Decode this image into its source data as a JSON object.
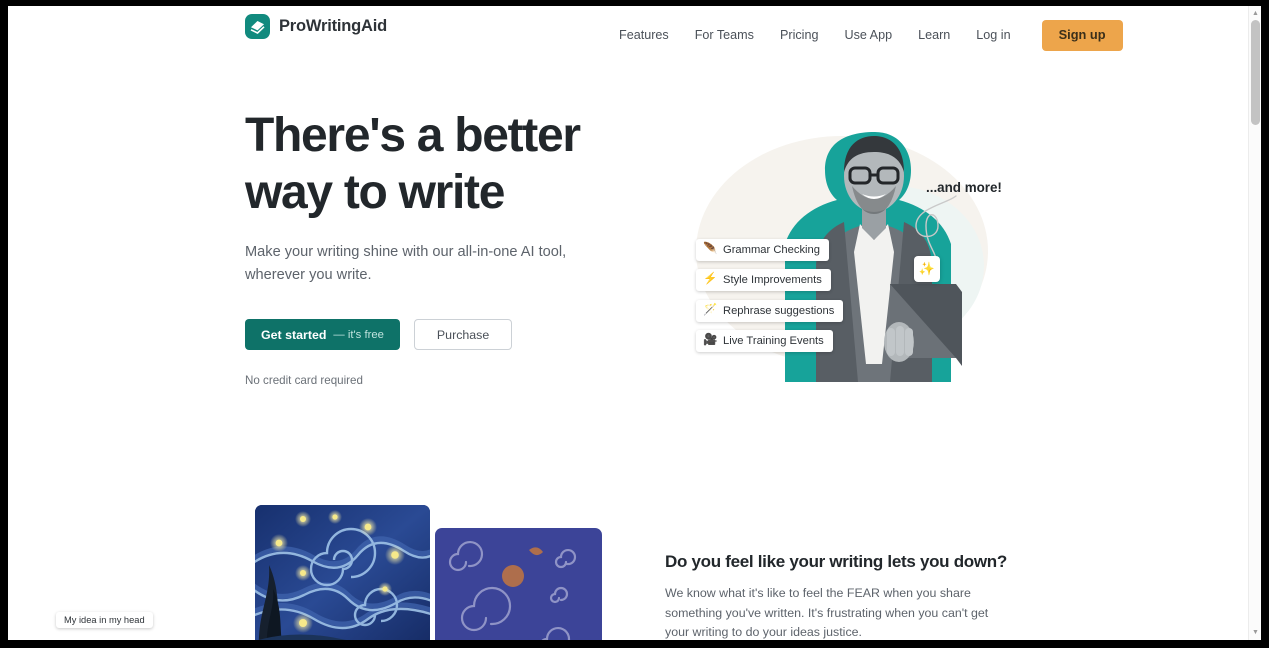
{
  "header": {
    "brand": "ProWritingAid",
    "logo_icon": "stacked-pages-icon",
    "logo_color": "#118a7e",
    "nav": [
      {
        "label": "Features"
      },
      {
        "label": "For Teams"
      },
      {
        "label": "Pricing"
      },
      {
        "label": "Use App"
      },
      {
        "label": "Learn"
      },
      {
        "label": "Log in"
      }
    ],
    "signup_label": "Sign up",
    "signup_color": "#eda54b"
  },
  "hero": {
    "title_line1": "There's a better",
    "title_line2": "way to write",
    "subtitle": "Make your writing shine with our all-in-one AI tool, wherever you write.",
    "cta_primary_main": "Get started",
    "cta_primary_suffix": "— it's free",
    "cta_primary_color": "#0e7268",
    "cta_secondary": "Purchase",
    "footnote": "No credit card required",
    "callout": "...and more!",
    "spark_icon": "sparkles-icon",
    "chips": [
      {
        "icon": "feather-pen-icon",
        "glyph": "🪶",
        "label": "Grammar Checking"
      },
      {
        "icon": "lightning-bolt-icon",
        "glyph": "⚡",
        "label": "Style Improvements"
      },
      {
        "icon": "magic-wand-icon",
        "glyph": "🪄",
        "label": "Rephrase suggestions"
      },
      {
        "icon": "video-camera-icon",
        "glyph": "🎥",
        "label": "Live Training Events"
      }
    ]
  },
  "lower": {
    "starry_caption": "My idea in my head",
    "title": "Do you feel like your writing lets you down?",
    "body": "We know what it's like to feel the FEAR when you share something you've written. It's frustrating when you can't get your writing to do your ideas justice."
  },
  "scrollbar": {
    "up_glyph": "▲",
    "down_glyph": "▼"
  }
}
